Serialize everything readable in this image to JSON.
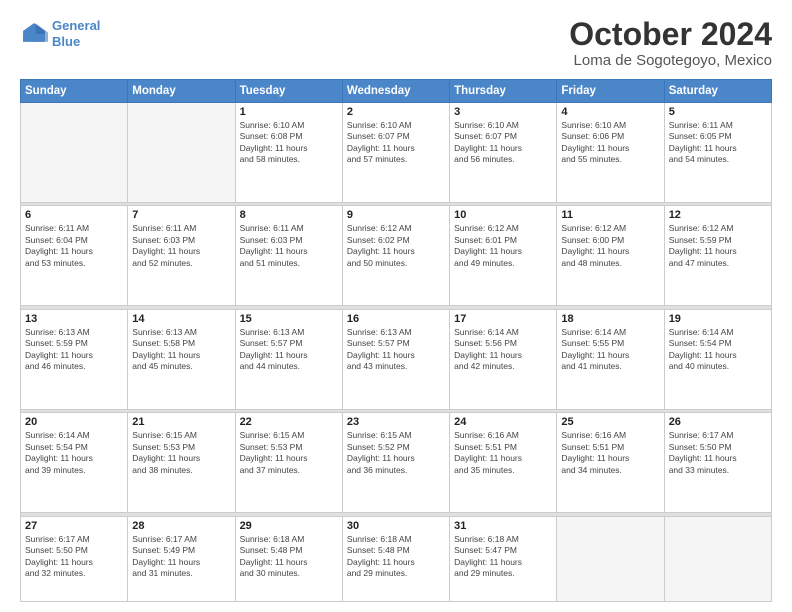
{
  "logo": {
    "line1": "General",
    "line2": "Blue"
  },
  "title": "October 2024",
  "location": "Loma de Sogotegoyo, Mexico",
  "days_of_week": [
    "Sunday",
    "Monday",
    "Tuesday",
    "Wednesday",
    "Thursday",
    "Friday",
    "Saturday"
  ],
  "weeks": [
    [
      {
        "num": "",
        "info": ""
      },
      {
        "num": "",
        "info": ""
      },
      {
        "num": "1",
        "info": "Sunrise: 6:10 AM\nSunset: 6:08 PM\nDaylight: 11 hours\nand 58 minutes."
      },
      {
        "num": "2",
        "info": "Sunrise: 6:10 AM\nSunset: 6:07 PM\nDaylight: 11 hours\nand 57 minutes."
      },
      {
        "num": "3",
        "info": "Sunrise: 6:10 AM\nSunset: 6:07 PM\nDaylight: 11 hours\nand 56 minutes."
      },
      {
        "num": "4",
        "info": "Sunrise: 6:10 AM\nSunset: 6:06 PM\nDaylight: 11 hours\nand 55 minutes."
      },
      {
        "num": "5",
        "info": "Sunrise: 6:11 AM\nSunset: 6:05 PM\nDaylight: 11 hours\nand 54 minutes."
      }
    ],
    [
      {
        "num": "6",
        "info": "Sunrise: 6:11 AM\nSunset: 6:04 PM\nDaylight: 11 hours\nand 53 minutes."
      },
      {
        "num": "7",
        "info": "Sunrise: 6:11 AM\nSunset: 6:03 PM\nDaylight: 11 hours\nand 52 minutes."
      },
      {
        "num": "8",
        "info": "Sunrise: 6:11 AM\nSunset: 6:03 PM\nDaylight: 11 hours\nand 51 minutes."
      },
      {
        "num": "9",
        "info": "Sunrise: 6:12 AM\nSunset: 6:02 PM\nDaylight: 11 hours\nand 50 minutes."
      },
      {
        "num": "10",
        "info": "Sunrise: 6:12 AM\nSunset: 6:01 PM\nDaylight: 11 hours\nand 49 minutes."
      },
      {
        "num": "11",
        "info": "Sunrise: 6:12 AM\nSunset: 6:00 PM\nDaylight: 11 hours\nand 48 minutes."
      },
      {
        "num": "12",
        "info": "Sunrise: 6:12 AM\nSunset: 5:59 PM\nDaylight: 11 hours\nand 47 minutes."
      }
    ],
    [
      {
        "num": "13",
        "info": "Sunrise: 6:13 AM\nSunset: 5:59 PM\nDaylight: 11 hours\nand 46 minutes."
      },
      {
        "num": "14",
        "info": "Sunrise: 6:13 AM\nSunset: 5:58 PM\nDaylight: 11 hours\nand 45 minutes."
      },
      {
        "num": "15",
        "info": "Sunrise: 6:13 AM\nSunset: 5:57 PM\nDaylight: 11 hours\nand 44 minutes."
      },
      {
        "num": "16",
        "info": "Sunrise: 6:13 AM\nSunset: 5:57 PM\nDaylight: 11 hours\nand 43 minutes."
      },
      {
        "num": "17",
        "info": "Sunrise: 6:14 AM\nSunset: 5:56 PM\nDaylight: 11 hours\nand 42 minutes."
      },
      {
        "num": "18",
        "info": "Sunrise: 6:14 AM\nSunset: 5:55 PM\nDaylight: 11 hours\nand 41 minutes."
      },
      {
        "num": "19",
        "info": "Sunrise: 6:14 AM\nSunset: 5:54 PM\nDaylight: 11 hours\nand 40 minutes."
      }
    ],
    [
      {
        "num": "20",
        "info": "Sunrise: 6:14 AM\nSunset: 5:54 PM\nDaylight: 11 hours\nand 39 minutes."
      },
      {
        "num": "21",
        "info": "Sunrise: 6:15 AM\nSunset: 5:53 PM\nDaylight: 11 hours\nand 38 minutes."
      },
      {
        "num": "22",
        "info": "Sunrise: 6:15 AM\nSunset: 5:53 PM\nDaylight: 11 hours\nand 37 minutes."
      },
      {
        "num": "23",
        "info": "Sunrise: 6:15 AM\nSunset: 5:52 PM\nDaylight: 11 hours\nand 36 minutes."
      },
      {
        "num": "24",
        "info": "Sunrise: 6:16 AM\nSunset: 5:51 PM\nDaylight: 11 hours\nand 35 minutes."
      },
      {
        "num": "25",
        "info": "Sunrise: 6:16 AM\nSunset: 5:51 PM\nDaylight: 11 hours\nand 34 minutes."
      },
      {
        "num": "26",
        "info": "Sunrise: 6:17 AM\nSunset: 5:50 PM\nDaylight: 11 hours\nand 33 minutes."
      }
    ],
    [
      {
        "num": "27",
        "info": "Sunrise: 6:17 AM\nSunset: 5:50 PM\nDaylight: 11 hours\nand 32 minutes."
      },
      {
        "num": "28",
        "info": "Sunrise: 6:17 AM\nSunset: 5:49 PM\nDaylight: 11 hours\nand 31 minutes."
      },
      {
        "num": "29",
        "info": "Sunrise: 6:18 AM\nSunset: 5:48 PM\nDaylight: 11 hours\nand 30 minutes."
      },
      {
        "num": "30",
        "info": "Sunrise: 6:18 AM\nSunset: 5:48 PM\nDaylight: 11 hours\nand 29 minutes."
      },
      {
        "num": "31",
        "info": "Sunrise: 6:18 AM\nSunset: 5:47 PM\nDaylight: 11 hours\nand 29 minutes."
      },
      {
        "num": "",
        "info": ""
      },
      {
        "num": "",
        "info": ""
      }
    ]
  ]
}
